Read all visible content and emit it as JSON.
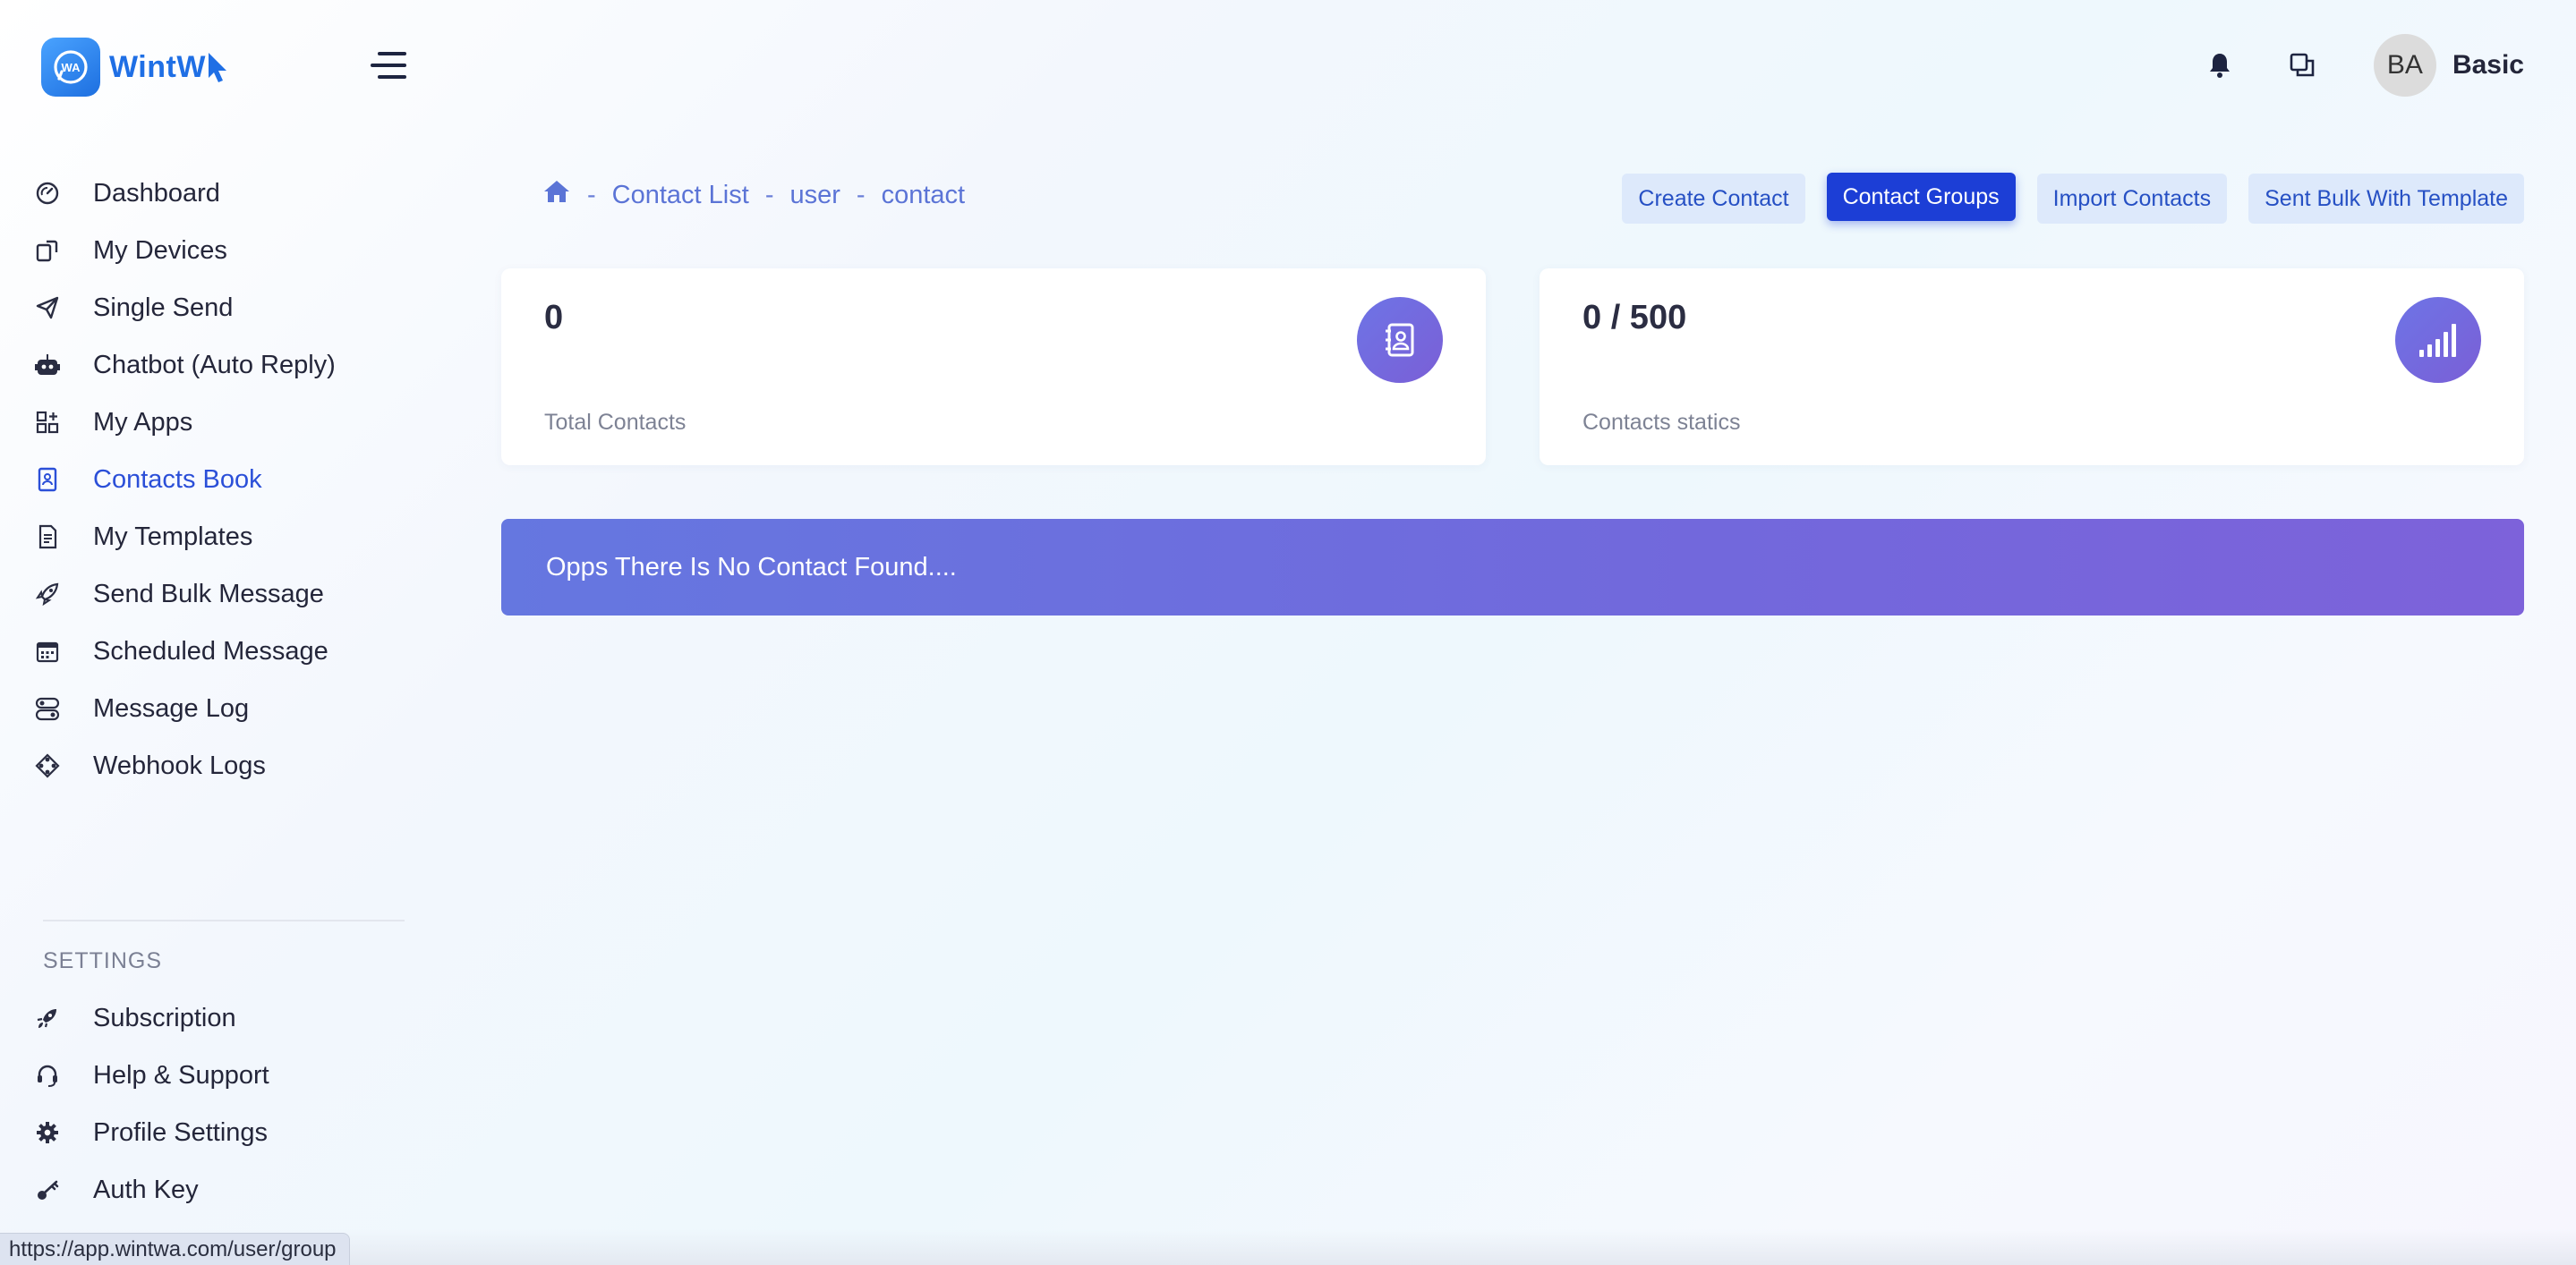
{
  "brand": {
    "name": "WintWA",
    "logo_text": "WintW",
    "accent": "#1f6fe5"
  },
  "sidebar": {
    "items": [
      {
        "label": "Dashboard",
        "icon": "gauge-icon"
      },
      {
        "label": "My Devices",
        "icon": "devices-icon"
      },
      {
        "label": "Single Send",
        "icon": "paper-plane-icon"
      },
      {
        "label": "Chatbot (Auto Reply)",
        "icon": "robot-icon"
      },
      {
        "label": "My Apps",
        "icon": "apps-grid-icon"
      },
      {
        "label": "Contacts Book",
        "icon": "contacts-book-icon",
        "active": true
      },
      {
        "label": "My Templates",
        "icon": "template-icon"
      },
      {
        "label": "Send Bulk Message",
        "icon": "rocket-icon"
      },
      {
        "label": "Scheduled Message",
        "icon": "calendar-icon"
      },
      {
        "label": "Message Log",
        "icon": "toggles-icon"
      },
      {
        "label": "Webhook Logs",
        "icon": "webhook-icon"
      }
    ],
    "settings_title": "SETTINGS",
    "settings_items": [
      {
        "label": "Subscription",
        "icon": "subscription-icon"
      },
      {
        "label": "Help & Support",
        "icon": "headset-icon"
      },
      {
        "label": "Profile Settings",
        "icon": "gear-icon"
      },
      {
        "label": "Auth Key",
        "icon": "key-icon"
      }
    ]
  },
  "header": {
    "avatar_initials": "BA",
    "username": "Basic"
  },
  "breadcrumb": {
    "items": [
      "Contact List",
      "user",
      "contact"
    ],
    "separator": "-"
  },
  "actions": {
    "create_contact": "Create Contact",
    "contact_groups": "Contact Groups",
    "import_contacts": "Import Contacts",
    "sent_bulk_template": "Sent Bulk With Template"
  },
  "stats": {
    "total": {
      "value": "0",
      "label": "Total Contacts"
    },
    "statics": {
      "value": "0 / 500",
      "label": "Contacts statics"
    }
  },
  "empty_state": "Opps There Is No Contact Found....",
  "status_bar_url": "https://app.wintwa.com/user/group"
}
